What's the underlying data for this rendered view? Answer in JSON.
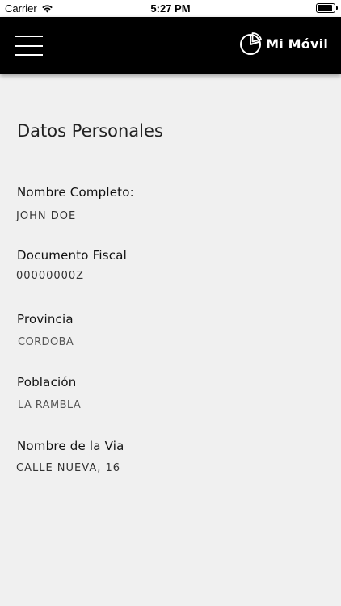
{
  "status_bar": {
    "carrier": "Carrier",
    "time": "5:27 PM",
    "battery_level": 0.9
  },
  "header": {
    "menu_icon": "hamburger-menu-icon",
    "logo_icon": "pie-chart-logo-icon",
    "brand_name": "Mi Móvil",
    "background_color": "#000000"
  },
  "page": {
    "title": "Datos Personales",
    "fields": [
      {
        "label": "Nombre Completo:",
        "value": "JOHN DOE"
      },
      {
        "label": "Documento Fiscal",
        "value": "00000000Z"
      },
      {
        "label": "Provincia",
        "value": "CORDOBA"
      },
      {
        "label": "Población",
        "value": "LA RAMBLA"
      },
      {
        "label": "Nombre de la Via",
        "value": "CALLE NUEVA, 16"
      }
    ]
  }
}
